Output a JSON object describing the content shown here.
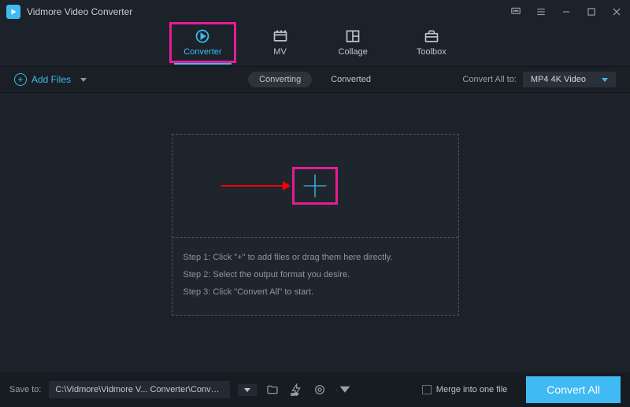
{
  "titlebar": {
    "title": "Vidmore Video Converter"
  },
  "tabs": {
    "converter": "Converter",
    "mv": "MV",
    "collage": "Collage",
    "toolbox": "Toolbox"
  },
  "subbar": {
    "add_files": "Add Files",
    "converting": "Converting",
    "converted": "Converted",
    "convert_all_to": "Convert All to:",
    "format_selected": "MP4 4K Video"
  },
  "steps": {
    "s1": "Step 1: Click \"+\" to add files or drag them here directly.",
    "s2": "Step 2: Select the output format you desire.",
    "s3": "Step 3: Click \"Convert All\" to start."
  },
  "bottom": {
    "save_to": "Save to:",
    "path": "C:\\Vidmore\\Vidmore V... Converter\\Converted",
    "merge": "Merge into one file",
    "convert_all": "Convert All"
  }
}
